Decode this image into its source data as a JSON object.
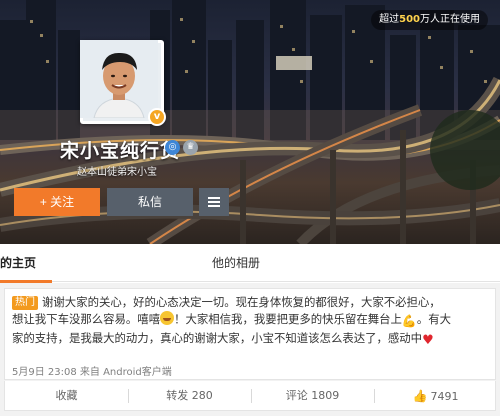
{
  "header": {
    "users_badge_prefix": "超过",
    "users_badge_count": "500",
    "users_badge_suffix": "万人正在使用",
    "profile_name": "宋小宝纯行货",
    "profile_subtitle": "赵本山徒弟宋小宝",
    "avatar_badge": "v",
    "follow_label": "+ 关注",
    "message_label": "私信",
    "accent_color": "#f27a2a"
  },
  "tabs": {
    "home": "的主页",
    "album": "他的相册"
  },
  "post": {
    "hot_tag": "热门",
    "line1": "谢谢大家的关心，好的心态决定一切。现在身体恢复的都很好，大家不必担心，",
    "line2a": "想让我下车没那么容易。嘻嘻",
    "line2b": "！大家相信我，我要把更多的快乐留在舞台上",
    "line2c": "。有大",
    "line3": "家的支持，是我最大的动力，真心的谢谢大家，小宝不知道该怎么表达了，感动中",
    "meta": "5月9日 23:08 来自 Android客户端"
  },
  "actions": {
    "favorite": "收藏",
    "repost": "转发 280",
    "comment": "评论 1809",
    "like": "7491"
  }
}
